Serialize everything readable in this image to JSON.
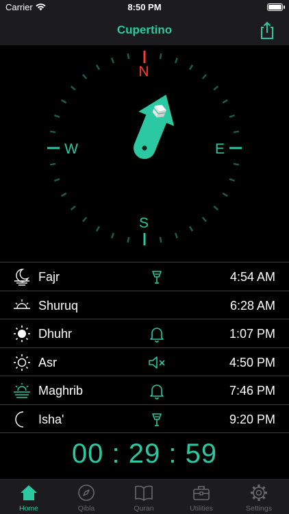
{
  "status_bar": {
    "carrier": "Carrier",
    "time": "8:50 PM",
    "battery_percent": 100
  },
  "nav": {
    "title": "Cupertino",
    "share_icon": "share-icon"
  },
  "compass": {
    "directions": {
      "north": "N",
      "east": "E",
      "south": "S",
      "west": "W"
    },
    "accent_color": "#2bc8a2",
    "north_color": "#ff3b30",
    "needle_icon": "kaaba-arrow-icon"
  },
  "prayers": [
    {
      "name": "Fajr",
      "time": "4:54 AM",
      "icon": "fajr-icon",
      "alert": "notification-on-icon"
    },
    {
      "name": "Shuruq",
      "time": "6:28 AM",
      "icon": "sunrise-icon",
      "alert": ""
    },
    {
      "name": "Dhuhr",
      "time": "1:07 PM",
      "icon": "sun-icon",
      "alert": "bell-icon"
    },
    {
      "name": "Asr",
      "time": "4:50 PM",
      "icon": "sun-outline-icon",
      "alert": "muted-icon"
    },
    {
      "name": "Maghrib",
      "time": "7:46 PM",
      "icon": "sunset-icon",
      "alert": "bell-icon"
    },
    {
      "name": "Isha'",
      "time": "9:20 PM",
      "icon": "moon-icon",
      "alert": "notification-on-icon"
    }
  ],
  "countdown": "00 : 29 : 59",
  "tabs": [
    {
      "label": "Home",
      "icon": "home-icon",
      "active": true
    },
    {
      "label": "Qibla",
      "icon": "compass-icon",
      "active": false
    },
    {
      "label": "Quran",
      "icon": "book-icon",
      "active": false
    },
    {
      "label": "Utilities",
      "icon": "toolbox-icon",
      "active": false
    },
    {
      "label": "Settings",
      "icon": "gear-icon",
      "active": false
    }
  ]
}
